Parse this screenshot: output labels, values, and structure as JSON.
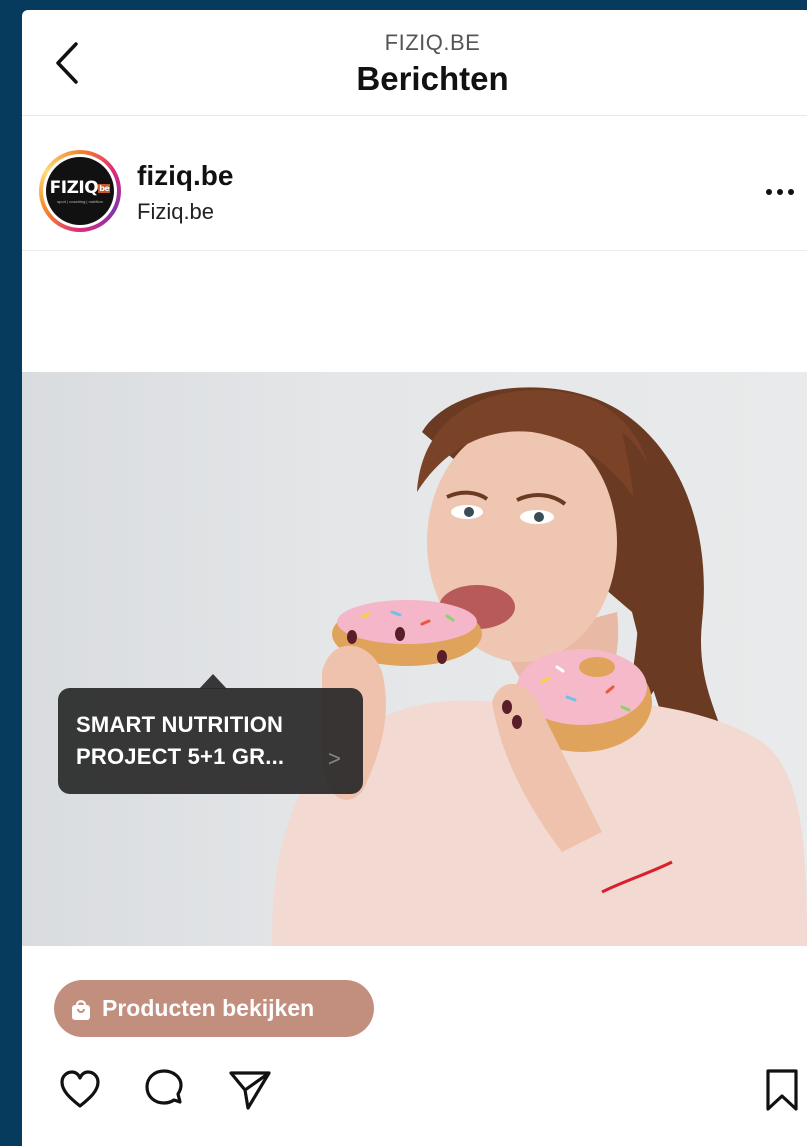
{
  "header": {
    "subtitle": "FIZIQ.BE",
    "title": "Berichten"
  },
  "post": {
    "username": "fiziq.be",
    "subname": "Fiziq.be",
    "avatar_logo": "FIZIQ",
    "avatar_logo_suffix": "be",
    "avatar_tagline": "sport | coaching | nutrition",
    "image_icon": "woman-eating-donuts-photo",
    "product_tag": {
      "line1": "SMART NUTRITION",
      "line2": "PROJECT 5+1 GR...",
      "chevron": ">"
    },
    "products_button": "Producten bekijken"
  },
  "icons": {
    "back": "chevron-left-icon",
    "more": "more-dots-icon",
    "like": "heart-icon",
    "comment": "comment-icon",
    "share": "send-icon",
    "save": "bookmark-icon",
    "bag": "shopping-bag-icon"
  },
  "colors": {
    "outer_bg": "#063b5e",
    "products_button_bg": "#c28f7e",
    "tag_bg": "#282828"
  }
}
